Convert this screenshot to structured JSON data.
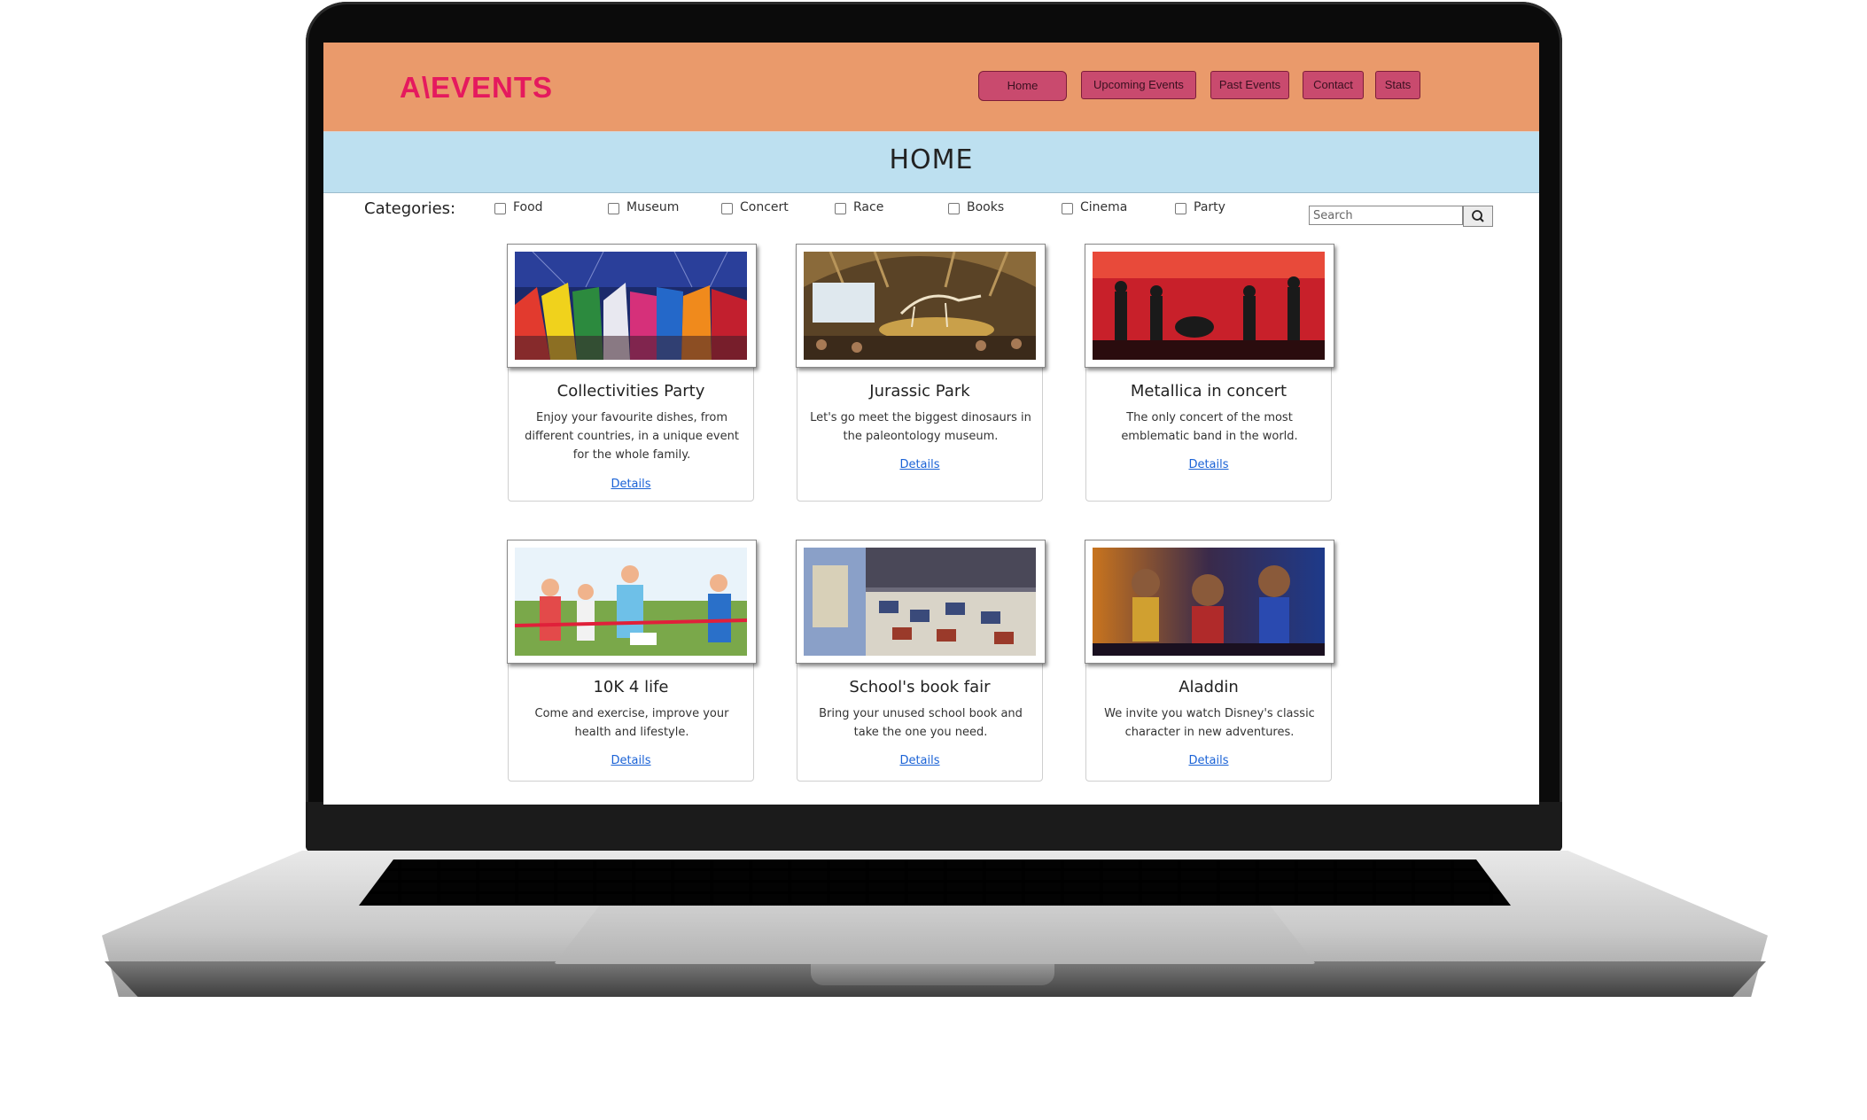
{
  "brand": {
    "logo": "A\\EVENTS",
    "logo_color": "#e5195e"
  },
  "nav": {
    "home": "Home",
    "upcoming": "Upcoming Events",
    "past": "Past Events",
    "contact": "Contact",
    "stats": "Stats"
  },
  "page": {
    "title": "HOME"
  },
  "filters": {
    "label": "Categories:",
    "items": [
      "Food",
      "Museum",
      "Concert",
      "Race",
      "Books",
      "Cinema",
      "Party"
    ],
    "search_placeholder": "Search"
  },
  "colors": {
    "topbar": "#ea9a6b",
    "titlebar": "#bde0f0",
    "nav_button": "#c94a6e",
    "link": "#1a62d6"
  },
  "events": [
    {
      "title": "Collectivities Party",
      "description": "Enjoy your favourite dishes, from different countries, in a unique event for the whole family.",
      "link": "Details",
      "image": "party-flags-image"
    },
    {
      "title": "Jurassic Park",
      "description": "Let's go meet the biggest dinosaurs in the paleontology museum.",
      "link": "Details",
      "image": "dinosaur-museum-image"
    },
    {
      "title": "Metallica in concert",
      "description": "The only concert of the most emblematic band in the world.",
      "link": "Details",
      "image": "rock-concert-image"
    },
    {
      "title": "10K 4 life",
      "description": "Come and exercise, improve your health and lifestyle.",
      "link": "Details",
      "image": "runners-race-image"
    },
    {
      "title": "School's book fair",
      "description": "Bring your unused school book and take the one you need.",
      "link": "Details",
      "image": "book-fair-image"
    },
    {
      "title": "Aladdin",
      "description": "We invite you watch Disney's classic character in new adventures.",
      "link": "Details",
      "image": "aladdin-poster-image"
    }
  ]
}
